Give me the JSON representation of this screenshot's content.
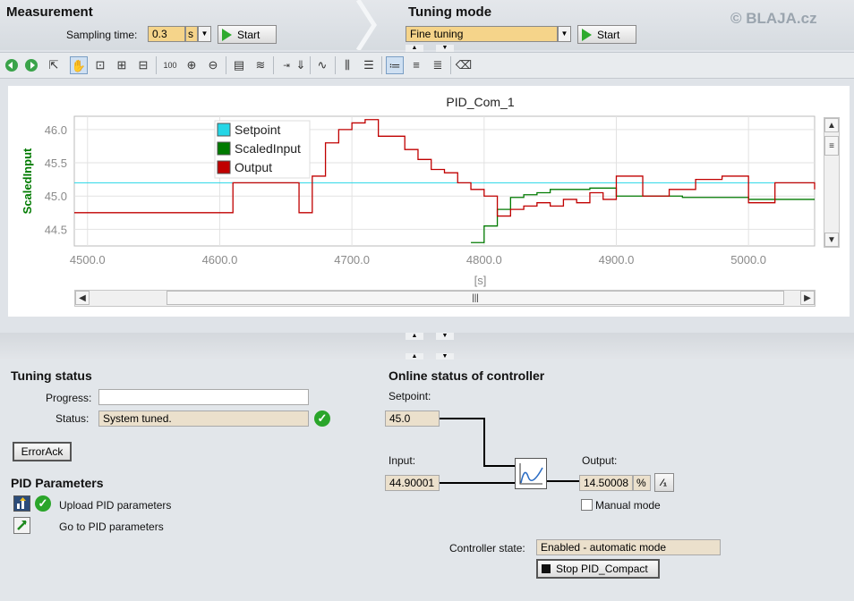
{
  "header": {
    "measurement": {
      "title": "Measurement",
      "sampling_label": "Sampling time:",
      "sampling_value": "0.3",
      "sampling_unit": "s",
      "start_label": "Start"
    },
    "tuning": {
      "title": "Tuning mode",
      "mode_value": "Fine tuning",
      "start_label": "Start"
    },
    "watermark": "© BLAJA.cz"
  },
  "toolbar": {
    "icons": [
      "back-icon",
      "forward-icon",
      "select-icon",
      "pan-icon",
      "zoom-box-icon",
      "zoom-x-icon",
      "zoom-y-icon",
      "zoom-100-icon",
      "zoom-in-icon",
      "zoom-out-icon",
      "fit-icon",
      "fit-y-icon",
      "marker-icon",
      "export-icon",
      "curve-icon",
      "vertical-ruler-icon",
      "horizontal-ruler-icon",
      "legend-left-icon",
      "legend-center-icon",
      "legend-right-icon",
      "clear-icon"
    ],
    "selected": [
      "pan-icon",
      "legend-left-icon"
    ]
  },
  "chart_data": {
    "type": "line",
    "title": "PID_Com_1",
    "xlabel": "[s]",
    "ylabel": "ScaledInput",
    "xlim": [
      4490,
      5050
    ],
    "ylim": [
      44.25,
      46.2
    ],
    "x_ticks": [
      "4500.0",
      "4600.0",
      "4700.0",
      "4800.0",
      "4900.0",
      "5000.0"
    ],
    "y_ticks": [
      "44.5",
      "45.0",
      "45.5",
      "46.0"
    ],
    "grid": true,
    "legend": {
      "position": "top-left",
      "entries": [
        "Setpoint",
        "ScaledInput",
        "Output"
      ]
    },
    "colors": {
      "setpoint": "#24d6e6",
      "scaled": "#007a00",
      "output": "#c00000"
    },
    "series": [
      {
        "name": "Setpoint",
        "x": [
          4490,
          5050
        ],
        "y": [
          45.2,
          45.2
        ]
      },
      {
        "name": "ScaledInput",
        "x": [
          4790,
          4800,
          4810,
          4820,
          4830,
          4840,
          4850,
          4860,
          4880,
          4900,
          4920,
          4950,
          5000,
          5050
        ],
        "y": [
          44.3,
          44.55,
          44.8,
          44.98,
          45.02,
          45.05,
          45.1,
          45.1,
          45.12,
          45.0,
          45.0,
          44.98,
          44.95,
          44.95
        ]
      },
      {
        "name": "Output",
        "x": [
          4490,
          4600,
          4610,
          4650,
          4660,
          4670,
          4680,
          4690,
          4700,
          4710,
          4720,
          4730,
          4740,
          4750,
          4760,
          4770,
          4780,
          4790,
          4800,
          4810,
          4820,
          4830,
          4840,
          4850,
          4860,
          4870,
          4880,
          4890,
          4900,
          4920,
          4940,
          4960,
          4980,
          5000,
          5020,
          5050
        ],
        "y": [
          44.75,
          44.75,
          45.2,
          45.2,
          44.75,
          45.3,
          45.8,
          46.0,
          46.1,
          46.15,
          45.9,
          45.9,
          45.7,
          45.55,
          45.4,
          45.35,
          45.2,
          45.1,
          45.0,
          44.7,
          44.8,
          44.85,
          44.9,
          44.85,
          44.95,
          44.9,
          45.05,
          44.95,
          45.3,
          45.0,
          45.1,
          45.25,
          45.3,
          44.9,
          45.2,
          45.1
        ]
      }
    ]
  },
  "tuning_status": {
    "title": "Tuning status",
    "progress_label": "Progress:",
    "progress_value": 0,
    "status_label": "Status:",
    "status_value": "System tuned.",
    "errorack_label": "ErrorAck"
  },
  "pid_parameters": {
    "title": "PID Parameters",
    "upload_label": "Upload PID parameters",
    "goto_label": "Go to PID parameters"
  },
  "online": {
    "title": "Online status of controller",
    "setpoint_label": "Setpoint:",
    "setpoint_value": "45.0",
    "input_label": "Input:",
    "input_value": "44.90001",
    "output_label": "Output:",
    "output_value": "14.50008",
    "output_unit": "%",
    "manual_label": "Manual mode",
    "state_label": "Controller state:",
    "state_value": "Enabled - automatic mode",
    "stop_label": "Stop PID_Compact"
  }
}
